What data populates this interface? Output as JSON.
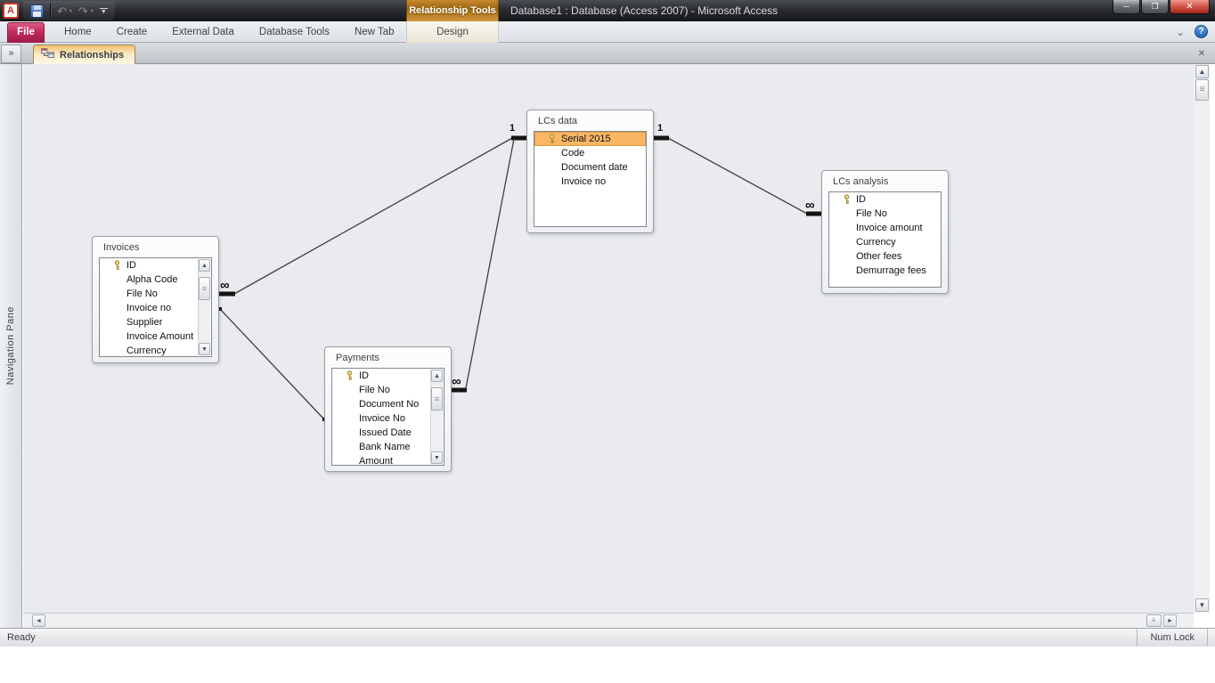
{
  "titlebar": {
    "contextual_tool_label": "Relationship Tools",
    "title": "Database1 : Database (Access 2007)  -  Microsoft Access"
  },
  "ribbon": {
    "file_label": "File",
    "tabs": [
      "Home",
      "Create",
      "External Data",
      "Database Tools",
      "New Tab"
    ],
    "contextual_tab_label": "Design"
  },
  "navpane": {
    "label": "Navigation Pane"
  },
  "doctab": {
    "label": "Relationships"
  },
  "icons": {
    "app_logo": "A",
    "undo": "↶",
    "redo": "↷",
    "dropdown_small": "▾",
    "qat_dropdown": "▼",
    "minimize": "─",
    "restore": "❐",
    "close": "✕",
    "ribbon_collapse": "⌄",
    "help": "?",
    "nav_expand": "»",
    "tab_close": "✕",
    "scroll_up": "▲",
    "scroll_down": "▼",
    "scroll_left": "◄",
    "scroll_right": "►",
    "thumb_grip": "≡"
  },
  "canvas": {
    "tables": [
      {
        "id": "invoices",
        "title": "Invoices",
        "has_scrollbar": true,
        "fields": [
          {
            "label": "ID",
            "key": true
          },
          {
            "label": "Alpha Code"
          },
          {
            "label": "File No"
          },
          {
            "label": "Invoice no"
          },
          {
            "label": "Supplier"
          },
          {
            "label": "Invoice Amount"
          },
          {
            "label": "Currency"
          }
        ]
      },
      {
        "id": "payments",
        "title": "Payments",
        "has_scrollbar": true,
        "fields": [
          {
            "label": "ID",
            "key": true
          },
          {
            "label": "File No"
          },
          {
            "label": "Document No"
          },
          {
            "label": "Invoice No"
          },
          {
            "label": "Issued Date"
          },
          {
            "label": "Bank Name"
          },
          {
            "label": "Amount"
          }
        ]
      },
      {
        "id": "lcs-data",
        "title": "LCs data",
        "has_scrollbar": false,
        "fields": [
          {
            "label": "Serial 2015",
            "key": true,
            "selected": true
          },
          {
            "label": "Code"
          },
          {
            "label": "Document date"
          },
          {
            "label": "Invoice no"
          }
        ]
      },
      {
        "id": "lcs-analysis",
        "title": "LCs analysis",
        "has_scrollbar": false,
        "fields": [
          {
            "label": "ID",
            "key": true
          },
          {
            "label": "File No"
          },
          {
            "label": "Invoice amount"
          },
          {
            "label": "Currency"
          },
          {
            "label": "Other fees"
          },
          {
            "label": "Demurrage fees"
          }
        ]
      }
    ],
    "relationships": [
      {
        "from_table": "LCs data",
        "to_table": "Invoices",
        "from_label": "1",
        "to_label": "∞"
      },
      {
        "from_table": "LCs data",
        "to_table": "Payments",
        "from_label": "1",
        "to_label": "∞"
      },
      {
        "from_table": "LCs data",
        "to_table": "LCs analysis",
        "from_label": "1",
        "to_label": "∞"
      },
      {
        "from_table": "Invoices",
        "to_table": "Payments",
        "from_label": "",
        "to_label": ""
      }
    ]
  },
  "statusbar": {
    "left": "Ready",
    "right": "Num Lock"
  },
  "colors": {
    "contextual_orange": "#b5791f",
    "file_tab_red": "#c22a5c",
    "doc_tab_orange": "#f4bf6d",
    "selected_field_bg": "#f9b766",
    "selected_field_border": "#e09a40",
    "canvas_bg": "#e9ebee"
  }
}
